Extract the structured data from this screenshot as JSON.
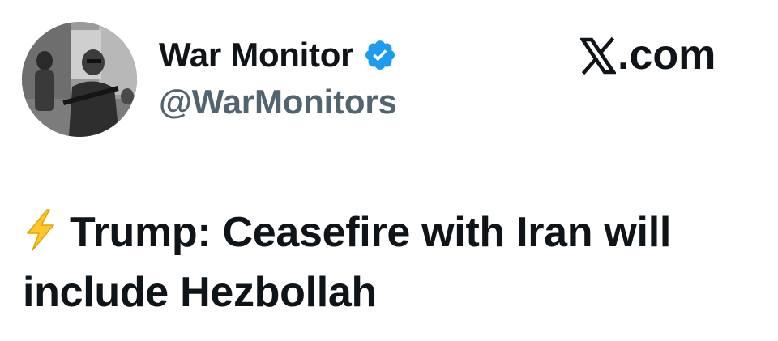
{
  "author": {
    "display_name": "War Monitor",
    "handle": "@WarMonitors",
    "verified": true,
    "avatar_icon": "profile-photo-grayscale",
    "verified_color": "#1d9bf0"
  },
  "brand": {
    "domain_text": ".com",
    "logo_icon": "x-logo-icon"
  },
  "tweet": {
    "prefix_icon": "high-voltage-emoji",
    "text": "Trump: Ceasefire with Iran will include Hezbollah"
  },
  "colors": {
    "text_primary": "#0f1419",
    "text_secondary": "#536471",
    "bolt_fill": "#ffc72c"
  }
}
